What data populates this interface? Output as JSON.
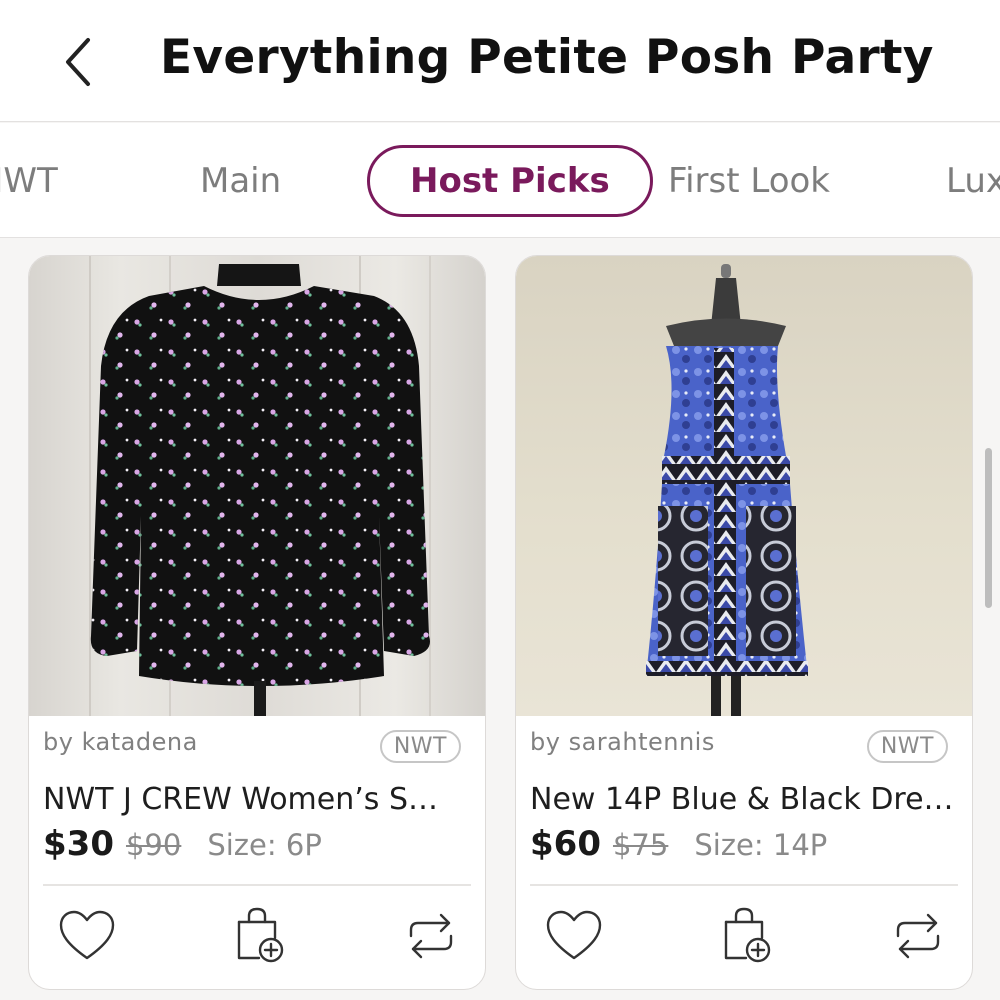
{
  "header": {
    "back_icon": "chevron-left-icon",
    "title": "Everything Petite Posh Party"
  },
  "tabs": [
    {
      "label": "NWT",
      "active": false
    },
    {
      "label": "Main",
      "active": false
    },
    {
      "label": "Host Picks",
      "active": true
    },
    {
      "label": "First Look",
      "active": false
    },
    {
      "label": "Luxury",
      "active": false
    }
  ],
  "accent_color": "#7a1a5c",
  "listings": [
    {
      "seller": "by katadena",
      "badge": "NWT",
      "title": "NWT J CREW Women’s S…",
      "price": "$30",
      "original_price": "$90",
      "size": "Size: 6P",
      "actions": [
        "heart-icon",
        "bag-add-icon",
        "share-icon"
      ]
    },
    {
      "seller": "by sarahtennis",
      "badge": "NWT",
      "title": "New 14P Blue & Black Dre…",
      "price": "$60",
      "original_price": "$75",
      "size": "Size: 14P",
      "actions": [
        "heart-icon",
        "bag-add-icon",
        "share-icon"
      ]
    }
  ]
}
